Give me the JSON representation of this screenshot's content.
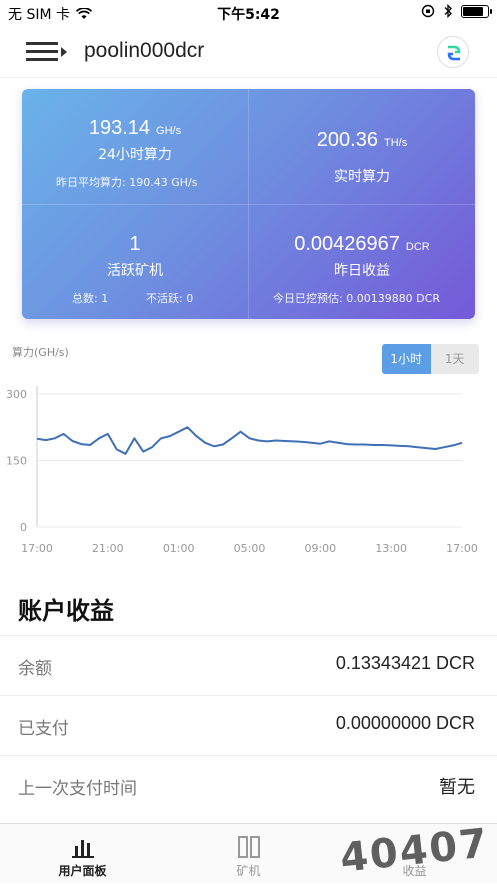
{
  "status_bar": {
    "carrier": "无 SIM 卡",
    "time": "下午5:42",
    "battery_level": 0.85
  },
  "app_bar": {
    "title": "poolin000dcr",
    "menu_icon": "menu-icon",
    "coin_icon": "decred-logo-icon"
  },
  "stats": {
    "hash_24h": {
      "value": "193.14",
      "unit": "GH/s",
      "label": "24小时算力",
      "sub": "昨日平均算力: 190.43 GH/s"
    },
    "hash_realtime": {
      "value": "200.36",
      "unit": "TH/s",
      "label": "实时算力"
    },
    "active_miners": {
      "value": "1",
      "label": "活跃矿机",
      "total": "总数: 1",
      "inactive": "不活跃:  0"
    },
    "yesterday_earnings": {
      "value": "0.00426967",
      "unit": "DCR",
      "label": "昨日收益",
      "estimate": "今日已挖预估: 0.00139880  DCR"
    }
  },
  "chart_header": {
    "ylabel": "算力(GH/s)",
    "toggle_hour": "1小时",
    "toggle_day": "1天"
  },
  "chart_data": {
    "type": "line",
    "title": "",
    "xlabel": "",
    "ylabel": "算力(GH/s)",
    "ylim": [
      0,
      300
    ],
    "yticks": [
      0,
      150,
      300
    ],
    "xticks": [
      "17:00",
      "21:00",
      "01:00",
      "05:00",
      "09:00",
      "13:00",
      "17:00"
    ],
    "grid": true,
    "series": [
      {
        "color": "#3f6fb5",
        "x": [
          0,
          0.5,
          1,
          1.5,
          2,
          2.5,
          3,
          3.5,
          4,
          4.5,
          5,
          5.5,
          6,
          6.5,
          7,
          7.5,
          8,
          8.5,
          9,
          9.5,
          10,
          10.5,
          11,
          11.5,
          12,
          12.5,
          13,
          13.5,
          14,
          14.5,
          15,
          15.5,
          16,
          16.5,
          17,
          17.5,
          18,
          18.5,
          19,
          19.5,
          20,
          20.5,
          21,
          21.5,
          22,
          22.5,
          23,
          23.5,
          24
        ],
        "values": [
          199,
          196,
          200,
          210,
          194,
          187,
          185,
          200,
          210,
          175,
          165,
          200,
          170,
          180,
          200,
          205,
          215,
          225,
          205,
          190,
          182,
          186,
          200,
          215,
          200,
          195,
          193,
          195,
          194,
          193,
          192,
          190,
          188,
          193,
          190,
          187,
          186,
          186,
          185,
          185,
          184,
          183,
          182,
          180,
          178,
          176,
          180,
          184,
          190
        ]
      }
    ]
  },
  "earnings": {
    "title": "账户收益",
    "rows": [
      {
        "key": "余额",
        "value": "0.13343421  DCR"
      },
      {
        "key": "已支付",
        "value": "0.00000000  DCR"
      },
      {
        "key": "上一次支付时间",
        "value": "暂无"
      }
    ]
  },
  "tabs": [
    {
      "label": "用户面板",
      "icon": "bar-chart-icon",
      "active": true
    },
    {
      "label": "矿机",
      "icon": "miner-icon",
      "active": false
    },
    {
      "label": "收益",
      "icon": "earnings-icon",
      "active": false
    }
  ],
  "watermark": "40407"
}
